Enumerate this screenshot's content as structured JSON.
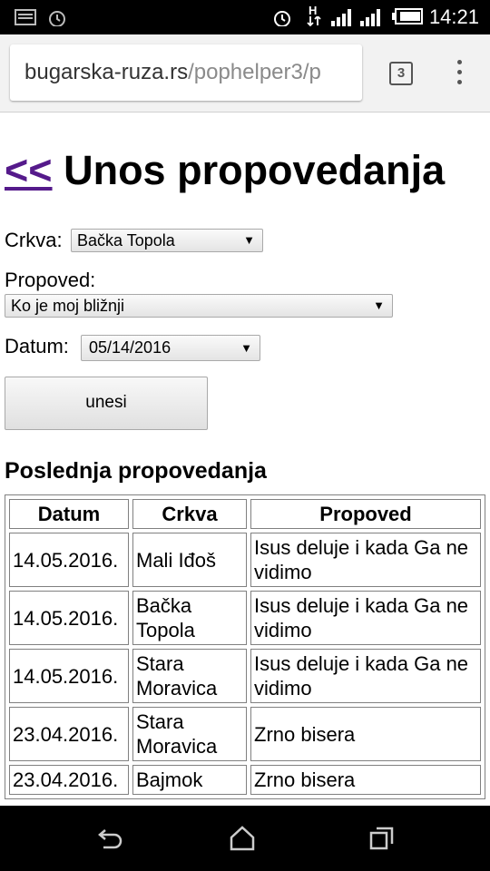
{
  "status_bar": {
    "time": "14:21",
    "icons": [
      "notification-icon",
      "alarm-icon",
      "alarm-icon",
      "signal-icon",
      "signal-icon",
      "battery-icon"
    ],
    "network_label": "H"
  },
  "browser": {
    "url_host": "bugarska-ruza.rs",
    "url_path": "/pophelper3/p",
    "tab_count": "3"
  },
  "page": {
    "back_link": "<<",
    "title": "Unos propovedanja",
    "form": {
      "crkva_label": "Crkva:",
      "crkva_value": "Bačka Topola",
      "propoved_label": "Propoved:",
      "propoved_value": "Ko je moj bližnji",
      "datum_label": "Datum:",
      "datum_value": "05/14/2016",
      "submit_label": "unesi"
    },
    "recent_heading": "Poslednja propovedanja",
    "table": {
      "headers": [
        "Datum",
        "Crkva",
        "Propoved"
      ],
      "rows": [
        [
          "14.05.2016.",
          "Mali Iđoš",
          "Isus deluje i kada Ga ne vidimo"
        ],
        [
          "14.05.2016.",
          "Bačka Topola",
          "Isus deluje i kada Ga ne vidimo"
        ],
        [
          "14.05.2016.",
          "Stara Moravica",
          "Isus deluje i kada Ga ne vidimo"
        ],
        [
          "23.04.2016.",
          "Stara Moravica",
          "Zrno bisera"
        ],
        [
          "23.04.2016.",
          "Bajmok",
          "Zrno bisera"
        ]
      ]
    }
  }
}
